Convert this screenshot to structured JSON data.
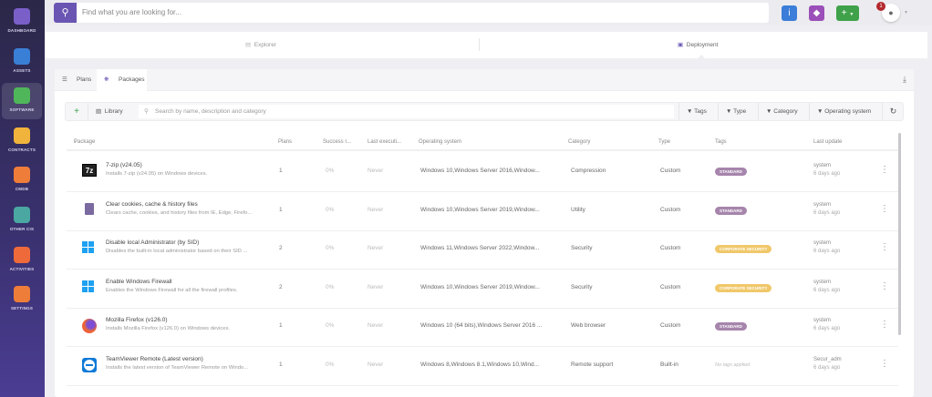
{
  "sidebar": {
    "items": [
      {
        "label": "DASHBOARD",
        "icon": "gauge-icon",
        "color": "#7b5fc9"
      },
      {
        "label": "ASSETS",
        "icon": "monitor-icon",
        "color": "#3a7fd6"
      },
      {
        "label": "SOFTWARE",
        "icon": "software-icon",
        "color": "#4fb65a",
        "active": true
      },
      {
        "label": "CONTRACTS",
        "icon": "contract-icon",
        "color": "#f0b33b"
      },
      {
        "label": "CMDB",
        "icon": "database-icon",
        "color": "#ef7d3a"
      },
      {
        "label": "OTHER CIS",
        "icon": "box-icon",
        "color": "#4aa7a2"
      },
      {
        "label": "ACTIVITIES",
        "icon": "clock-icon",
        "color": "#ef6a3a"
      },
      {
        "label": "SETTINGS",
        "icon": "gears-icon",
        "color": "#ef7d3a"
      }
    ]
  },
  "topbar": {
    "search_placeholder": "Find what you are looking for...",
    "notification_count": "1"
  },
  "deploy_tabs": {
    "explorer": "Explorer",
    "deployment": "Deployment"
  },
  "card_tabs": {
    "plans": "Plans",
    "packages": "Packages"
  },
  "toolbar": {
    "library": "Library",
    "search_placeholder": "Search by name, description and category",
    "filters": [
      "Tags",
      "Type",
      "Category",
      "Operating system"
    ]
  },
  "table": {
    "headers": {
      "package": "Package",
      "plans": "Plans",
      "success": "Success r...",
      "last_exec": "Last executi...",
      "os": "Operating system",
      "category": "Category",
      "type": "Type",
      "tags": "Tags",
      "last_update": "Last update"
    },
    "rows": [
      {
        "name": "7-zip (v24.05)",
        "desc": "Installs 7-zip (v24.05) on Windows devices.",
        "icon": "7zip-icon",
        "plans": "1",
        "success": "0%",
        "last_exec": "Never",
        "os": "Windows 10,Windows Server 2016,Window...",
        "category": "Compression",
        "type": "Custom",
        "tag": "STANDARD",
        "tag_color": "#a685ac",
        "user": "system",
        "updated": "6 days ago"
      },
      {
        "name": "Clear cookies, cache & history files",
        "desc": "Clears cache, cookies, and history files from IE, Edge, Firefo...",
        "icon": "trash-icon",
        "plans": "1",
        "success": "0%",
        "last_exec": "Never",
        "os": "Windows 10,Windows Server 2019,Window...",
        "category": "Utility",
        "type": "Custom",
        "tag": "STANDARD",
        "tag_color": "#a685ac",
        "user": "system",
        "updated": "6 days ago"
      },
      {
        "name": "Disable local Administrator (by SID)",
        "desc": "Disables the built-in local administrator based on their SID ...",
        "icon": "windows-icon",
        "plans": "2",
        "success": "0%",
        "last_exec": "Never",
        "os": "Windows 11,Windows Server 2022,Window...",
        "category": "Security",
        "type": "Custom",
        "tag": "CORPORATE SECURITY",
        "tag_color": "#f0c86a",
        "user": "system",
        "updated": "6 days ago"
      },
      {
        "name": "Enable Windows Firewall",
        "desc": "Enables the Windows Firewall for all the firewall profiles.",
        "icon": "windows-icon",
        "plans": "2",
        "success": "0%",
        "last_exec": "Never",
        "os": "Windows 10,Windows Server 2019,Window...",
        "category": "Security",
        "type": "Custom",
        "tag": "CORPORATE SECURITY",
        "tag_color": "#f0c86a",
        "user": "system",
        "updated": "6 days ago"
      },
      {
        "name": "Mozilla Firefox (v126.0)",
        "desc": "Installs Mozilla Firefox (v126.0) on Windows devices.",
        "icon": "firefox-icon",
        "plans": "1",
        "success": "0%",
        "last_exec": "Never",
        "os": "Windows 10 (64 bits),Windows Server 2016 ...",
        "category": "Web browser",
        "type": "Custom",
        "tag": "STANDARD",
        "tag_color": "#a685ac",
        "user": "system",
        "updated": "6 days ago"
      },
      {
        "name": "TeamViewer Remote (Latest version)",
        "desc": "Installs the latest version of TeamViewer Remote on Windo...",
        "icon": "teamviewer-icon",
        "plans": "1",
        "success": "0%",
        "last_exec": "Never",
        "os": "Windows 8,Windows 8.1,Windows 10,Wind...",
        "category": "Remote support",
        "type": "Built-in",
        "tag": "No tags applied",
        "tag_color": "",
        "user": "Secur_adm",
        "updated": "6 days ago"
      }
    ]
  }
}
